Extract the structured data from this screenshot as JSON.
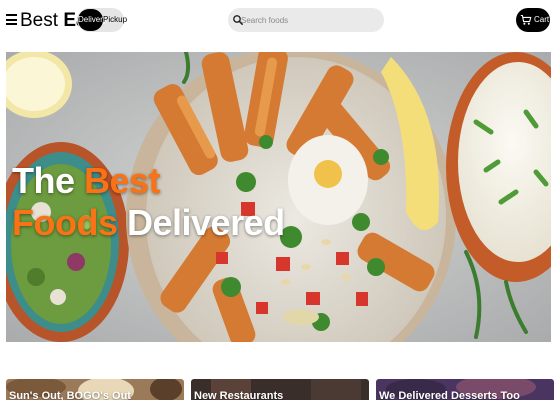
{
  "header": {
    "brand_light": "Best",
    "brand_bold": "Eats",
    "toggle": {
      "active": "Delivery",
      "inactive": "Pickup"
    },
    "search": {
      "placeholder": "Search foods"
    },
    "cart": {
      "label": "Cart"
    }
  },
  "hero": {
    "title_line1_white": "The",
    "title_line1_accent": "Best",
    "title_line2_accent": "Foods",
    "title_line2_white": "Delivered",
    "accent_color": "#f97316"
  },
  "cards": [
    {
      "label": "Sun's Out, BOGO's Out"
    },
    {
      "label": "New Restaurants"
    },
    {
      "label": "We Delivered Desserts Too"
    }
  ],
  "icons": [
    "menu-icon",
    "search-icon",
    "cart-icon"
  ]
}
